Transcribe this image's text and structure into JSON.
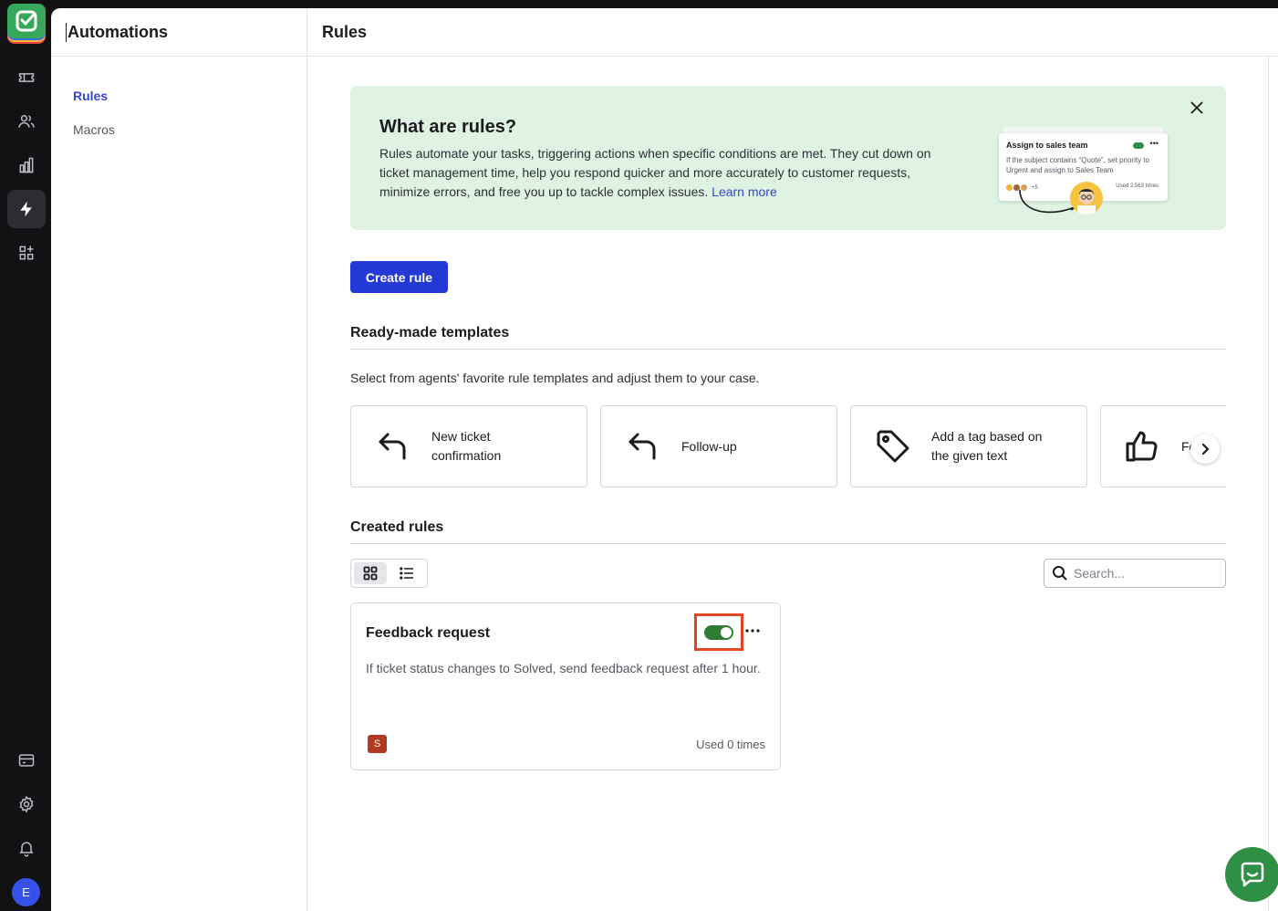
{
  "subnav": {
    "title": "Automations",
    "items": [
      {
        "label": "Rules",
        "active": true
      },
      {
        "label": "Macros",
        "active": false
      }
    ]
  },
  "header": {
    "title": "Rules"
  },
  "banner": {
    "title": "What are rules?",
    "text": "Rules automate your tasks, triggering actions when specific conditions are met. They cut down on ticket management time, help you respond quicker and more accurately to customer requests, minimize errors, and free you up to tackle complex issues.",
    "link": "Learn more",
    "preview": {
      "title": "Assign to sales team",
      "description": "If the subject contains “Quote”, set priority to Urgent and assign to Sales Team",
      "extra": "+5",
      "used": "Used 2,563 times"
    }
  },
  "create_button": "Create rule",
  "templates_section": {
    "title": "Ready-made templates",
    "description": "Select from agents' favorite rule templates and adjust them to your case.",
    "items": [
      {
        "label": "New ticket confirmation",
        "icon": "reply-arrow-icon"
      },
      {
        "label": "Follow-up",
        "icon": "reply-arrow-icon"
      },
      {
        "label": "Add a tag based on the given text",
        "icon": "tag-icon"
      },
      {
        "label": "Fe            a",
        "icon": "thumbs-up-icon"
      }
    ]
  },
  "created_section": {
    "title": "Created rules",
    "search_placeholder": "Search...",
    "rules": [
      {
        "title": "Feedback request",
        "enabled": true,
        "description": "If ticket status changes to Solved, send feedback request after 1 hour.",
        "author_initial": "S",
        "usage": "Used 0 times"
      }
    ]
  },
  "user": {
    "initial": "E"
  },
  "colors": {
    "accent": "#2438d6",
    "toggle_on": "#2f7d32",
    "highlight": "#e0461f",
    "banner_bg": "#dff3e2",
    "rail_bg": "#121214"
  }
}
